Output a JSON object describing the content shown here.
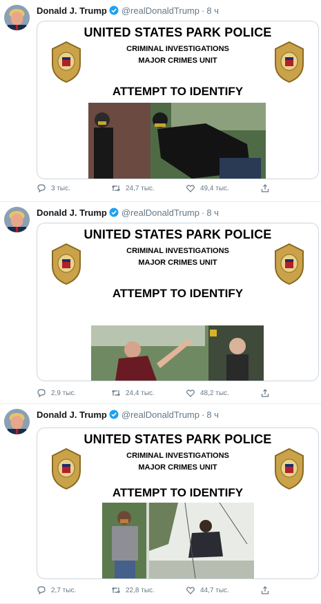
{
  "tweets": [
    {
      "author": {
        "name": "Donald J. Trump",
        "handle": "@realDonaldTrump",
        "time": "8 ч"
      },
      "card": {
        "headline": "UNITED STATES PARK POLICE",
        "sub1": "CRIMINAL INVESTIGATIONS",
        "sub2": "MAJOR CRIMES UNIT",
        "attempt": "ATTEMPT TO IDENTIFY"
      },
      "stats": {
        "replies": "3 тыс.",
        "retweets": "24,7 тыс.",
        "likes": "49,4 тыс."
      }
    },
    {
      "author": {
        "name": "Donald J. Trump",
        "handle": "@realDonaldTrump",
        "time": "8 ч"
      },
      "card": {
        "headline": "UNITED STATES PARK POLICE",
        "sub1": "CRIMINAL INVESTIGATIONS",
        "sub2": "MAJOR CRIMES UNIT",
        "attempt": "ATTEMPT TO IDENTIFY"
      },
      "stats": {
        "replies": "2,9 тыс.",
        "retweets": "24,4 тыс.",
        "likes": "48,2 тыс."
      }
    },
    {
      "author": {
        "name": "Donald J. Trump",
        "handle": "@realDonaldTrump",
        "time": "8 ч"
      },
      "card": {
        "headline": "UNITED STATES PARK POLICE",
        "sub1": "CRIMINAL INVESTIGATIONS",
        "sub2": "MAJOR CRIMES UNIT",
        "attempt": "ATTEMPT TO IDENTIFY"
      },
      "stats": {
        "replies": "2,7 тыс.",
        "retweets": "22,8 тыс.",
        "likes": "44,7 тыс."
      }
    }
  ],
  "icons": {
    "reply": "speech-bubble-icon",
    "retweet": "retweet-arrows-icon",
    "like": "heart-icon",
    "share": "share-upload-icon",
    "verified": "verified-badge-icon",
    "badge": "park-police-shield-icon"
  },
  "colors": {
    "verified": "#1da1f2",
    "muted": "#657786",
    "border": "#e6ecf0",
    "badge_gold": "#c9a24a"
  }
}
